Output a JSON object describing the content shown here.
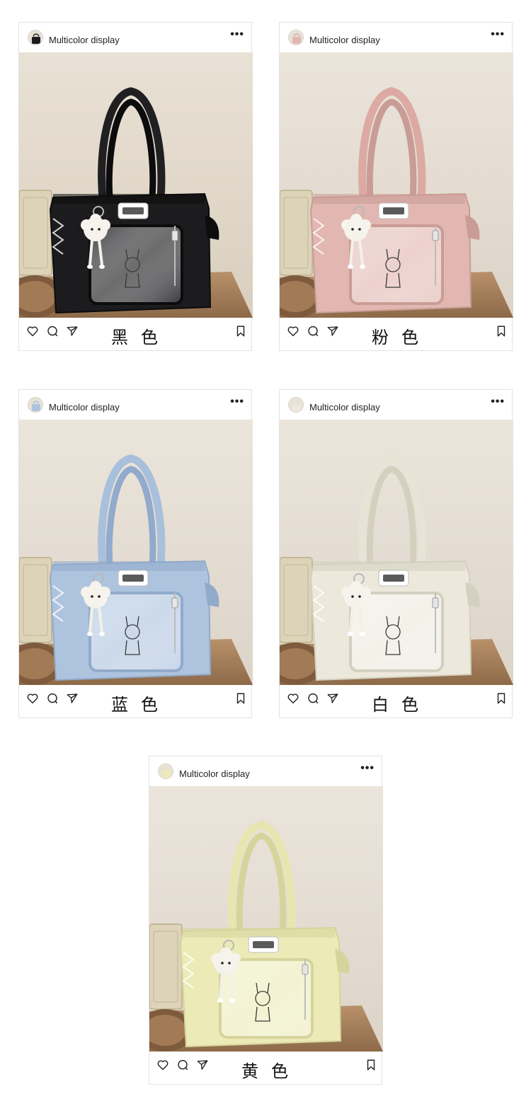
{
  "posts": [
    {
      "username": "Multicolor display",
      "more_label": "•••",
      "caption": "黑色",
      "colors": {
        "bag": "#1c1c1e",
        "bag_shadow": "#0c0c0d",
        "strap": "#202022",
        "window": "#3a3b3f",
        "bg_top": "#e9e1d5",
        "bg_bottom": "#d9cfbf"
      },
      "icons": [
        "heart-icon",
        "comment-icon",
        "share-icon",
        "bookmark-icon"
      ]
    },
    {
      "username": "Multicolor display",
      "more_label": "•••",
      "caption": "粉色",
      "colors": {
        "bag": "#e2b7b1",
        "bag_shadow": "#c99c95",
        "strap": "#dcaaa3",
        "window": "#ead0cb",
        "bg_top": "#ebe4db",
        "bg_bottom": "#ddd4c8"
      },
      "icons": [
        "heart-icon",
        "comment-icon",
        "share-icon",
        "bookmark-icon"
      ]
    },
    {
      "username": "Multicolor display",
      "more_label": "•••",
      "caption": "蓝色",
      "colors": {
        "bag": "#aec4de",
        "bag_shadow": "#92aacb",
        "strap": "#a9c0dc",
        "window": "#c8d7ea",
        "bg_top": "#ebe5dc",
        "bg_bottom": "#ddd4c8"
      },
      "icons": [
        "heart-icon",
        "comment-icon",
        "share-icon",
        "bookmark-icon"
      ]
    },
    {
      "username": "Multicolor display",
      "more_label": "•••",
      "caption": "白色",
      "colors": {
        "bag": "#ece9dc",
        "bag_shadow": "#d4d0c0",
        "strap": "#e8e4d5",
        "window": "#f3f2ea",
        "bg_top": "#ebe5dc",
        "bg_bottom": "#ddd4c8"
      },
      "icons": [
        "heart-icon",
        "comment-icon",
        "share-icon",
        "bookmark-icon"
      ]
    },
    {
      "username": "Multicolor display",
      "more_label": "•••",
      "caption": "黄色",
      "colors": {
        "bag": "#ecebb8",
        "bag_shadow": "#d6d49c",
        "strap": "#e8e6b0",
        "window": "#f3f2d3",
        "bg_top": "#ebe5dc",
        "bg_bottom": "#ddd4c8"
      },
      "icons": [
        "heart-icon",
        "comment-icon",
        "share-icon",
        "bookmark-icon"
      ]
    }
  ]
}
